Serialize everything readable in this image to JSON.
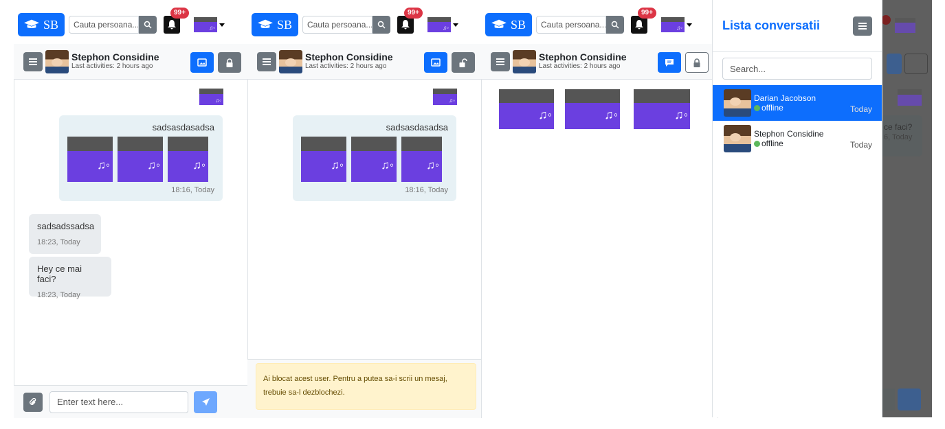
{
  "nav": {
    "brand": "SB",
    "search_placeholder": "Cauta persoana...",
    "badge": "99+"
  },
  "chat": {
    "name": "Stephon Considine",
    "status": "Last activities: 2 hours ago",
    "sent": {
      "text": "sadsasdasadsa",
      "time": "18:16, Today"
    },
    "received": [
      {
        "text": "sadsadssadsa",
        "time": "18:23, Today"
      },
      {
        "text": "Hey ce mai faci?",
        "time": "18:23, Today"
      }
    ],
    "input_placeholder": "Enter text here..."
  },
  "blocked_alert": "Ai blocat acest user. Pentru a putea sa-i scrii un mesaj, trebuie sa-l dezblochezi.",
  "sidebar": {
    "title": "Lista conversatii",
    "search_placeholder": "Search...",
    "conversations": [
      {
        "name": "Darian Jacobson",
        "status": "offline",
        "time": "Today",
        "active": true
      },
      {
        "name": "Stephon Considine",
        "status": "offline",
        "time": "Today",
        "active": false
      }
    ]
  },
  "behind": {
    "text": "ce faci?",
    "time": "6, Today"
  },
  "colors": {
    "primary": "#0d6efd",
    "secondary": "#6c757d",
    "alert_bg": "#fff3cd",
    "online": "#5cb85c",
    "thumb": "#6b3fe0"
  }
}
